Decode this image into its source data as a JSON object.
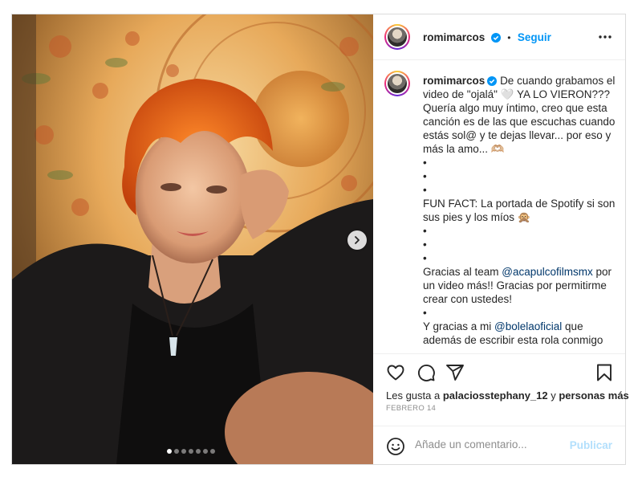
{
  "post": {
    "username": "romimarcos",
    "follow_label": "Seguir",
    "separator": "•",
    "carousel": {
      "total": 7,
      "active_index": 0
    }
  },
  "caption": {
    "username": "romimarcos",
    "lines": [
      "De cuando grabamos el video de \"ojalá\" 🤍 YA LO VIERON??? Quería algo muy íntimo, creo que esta canción es de las que escuchas cuando estás sol@ y te dejas llevar... por eso y más la amo... 🫶🏼",
      "•",
      "•",
      "•",
      "FUN FACT: La portada de Spotify si son sus pies y los míos 🙊",
      "•",
      "•",
      "•"
    ],
    "thanks_prefix": "Gracias al team ",
    "thanks_mention": "@acapulcofilmsmx",
    "thanks_suffix": " por un video más!! Gracias por permitirme crear con ustedes!",
    "bullet": "•",
    "also_prefix": "Y gracias a mi ",
    "also_mention": "@bolelaoficial",
    "also_suffix": " que además de escribir esta rola conmigo"
  },
  "likes": {
    "prefix": "Les gusta a ",
    "user": "palaciosstephany_12",
    "middle": " y ",
    "suffix": "personas más"
  },
  "date": "FEBRERO 14",
  "comment": {
    "placeholder": "Añade un comentario...",
    "post_label": "Publicar"
  },
  "colors": {
    "link": "#0095f6",
    "mention": "#00376b",
    "post_disabled": "#b2dffc",
    "muted": "#8e8e8e"
  },
  "icons": [
    "verified-badge-icon",
    "more-options-icon",
    "next-arrow-icon",
    "heart-icon",
    "comment-icon",
    "share-icon",
    "bookmark-icon",
    "emoji-icon"
  ]
}
